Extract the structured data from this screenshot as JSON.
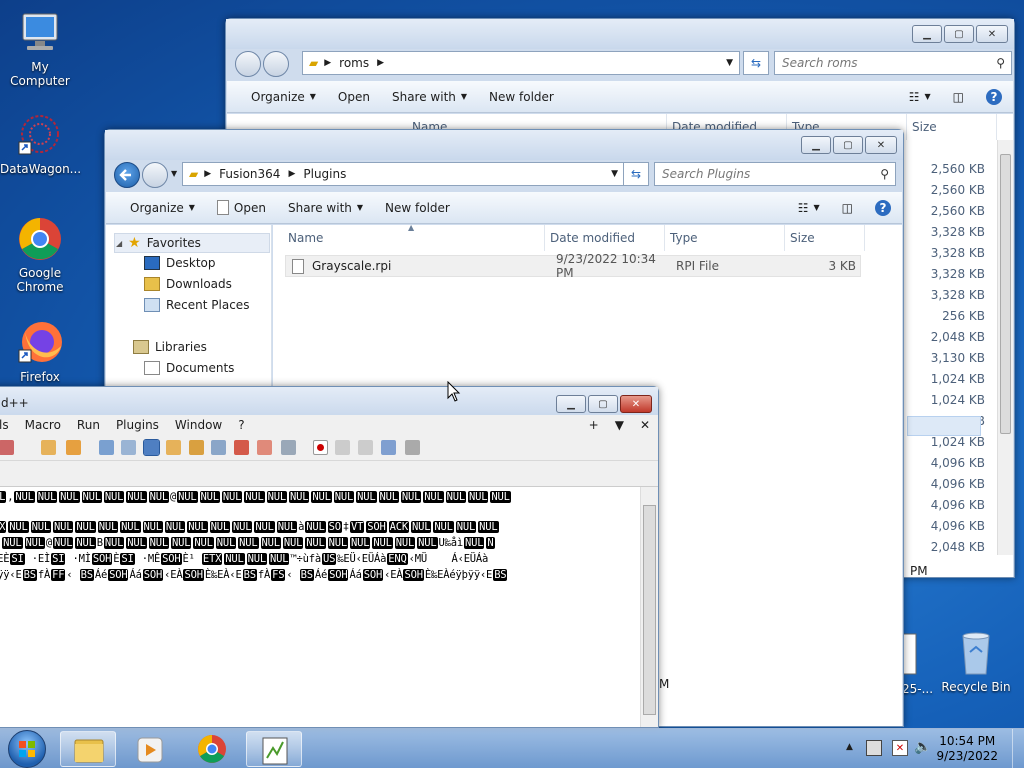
{
  "desktop": {
    "icons": [
      {
        "label": "My Computer"
      },
      {
        "label": "DataWagon..."
      },
      {
        "label": "Google Chrome"
      },
      {
        "label": "Firefox"
      },
      {
        "label": "Recycle Bin"
      }
    ],
    "partial_file_label": "25-..."
  },
  "roms_window": {
    "breadcrumb": [
      "roms"
    ],
    "search_placeholder": "Search roms",
    "commands": {
      "organize": "Organize",
      "open": "Open",
      "share": "Share with",
      "new_folder": "New folder"
    },
    "col_headers": {
      "name": "Name",
      "date": "Date modified",
      "type": "Type",
      "size": "Size"
    },
    "sizes": [
      "2,560 KB",
      "2,560 KB",
      "2,560 KB",
      "3,328 KB",
      "3,328 KB",
      "3,328 KB",
      "3,328 KB",
      "256 KB",
      "2,048 KB",
      "3,130 KB",
      "1,024 KB",
      "1,024 KB",
      "1,024 KB",
      "1,024 KB",
      "4,096 KB",
      "4,096 KB",
      "4,096 KB",
      "4,096 KB",
      "2,048 KB"
    ],
    "status_fragment": "PM",
    "status_fragment2": "M"
  },
  "plugins_window": {
    "breadcrumb": [
      "Fusion364",
      "Plugins"
    ],
    "search_placeholder": "Search Plugins",
    "commands": {
      "organize": "Organize",
      "open": "Open",
      "share": "Share with",
      "new_folder": "New folder"
    },
    "nav": {
      "favorites": "Favorites",
      "desktop": "Desktop",
      "downloads": "Downloads",
      "recent": "Recent Places",
      "libraries": "Libraries",
      "documents": "Documents"
    },
    "col_headers": {
      "name": "Name",
      "date": "Date modified",
      "type": "Type",
      "size": "Size"
    },
    "files": [
      {
        "name": "Grayscale.rpi",
        "date": "9/23/2022 10:34 PM",
        "type": "RPI File",
        "size": "3 KB"
      }
    ]
  },
  "notepad": {
    "title": "d++",
    "menu": [
      "ls",
      "Macro",
      "Run",
      "Plugins",
      "Window",
      "?"
    ],
    "menu_right": [
      "+",
      "▼",
      "✕"
    ]
  },
  "taskbar": {
    "time": "10:54 PM",
    "date": "9/23/2022"
  },
  "colors": {
    "selection": "#cce8ff",
    "accent": "#1d5fa8"
  }
}
